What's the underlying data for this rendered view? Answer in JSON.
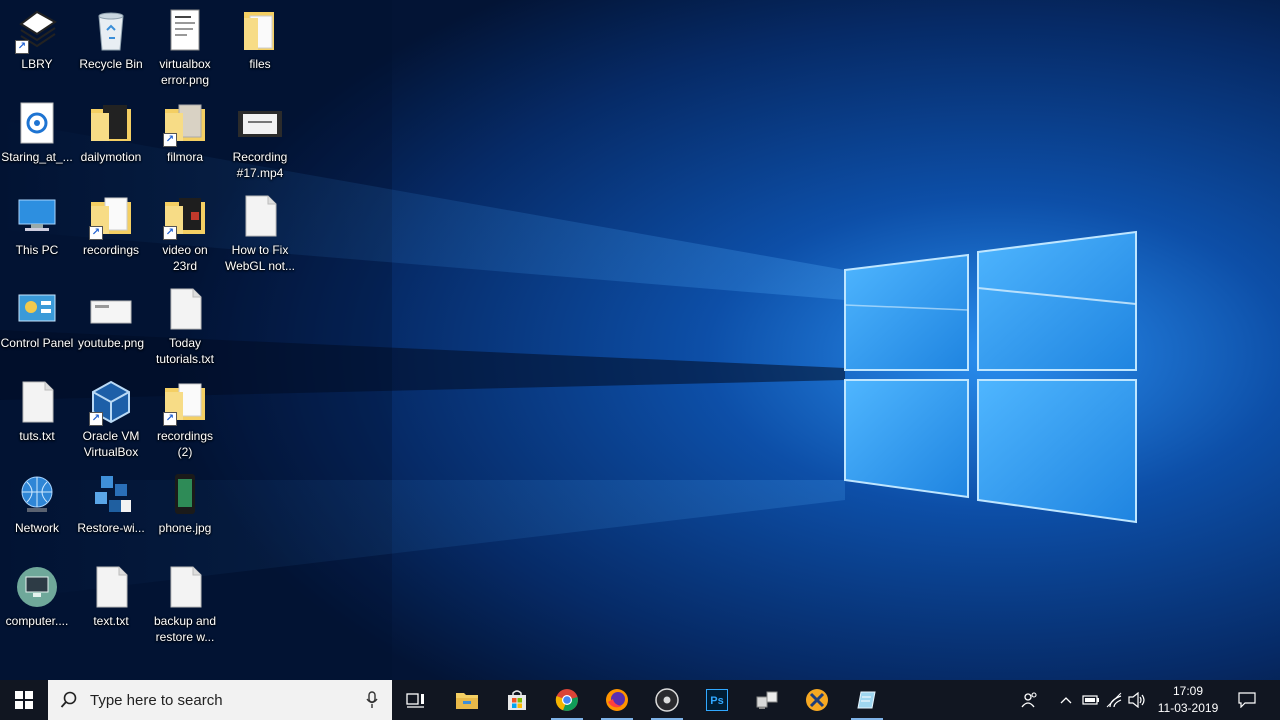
{
  "desktop": {
    "icons": [
      {
        "label": "LBRY",
        "icon": "lbry-app-icon"
      },
      {
        "label": "Recycle Bin",
        "icon": "recycle-bin-icon"
      },
      {
        "label": "virtualbox\nerror.png",
        "icon": "image-file-icon"
      },
      {
        "label": "files",
        "icon": "folder-icon"
      },
      {
        "label": "Staring_at_...",
        "icon": "media-file-icon"
      },
      {
        "label": "dailymotion",
        "icon": "folder-icon"
      },
      {
        "label": "filmora",
        "icon": "folder-icon"
      },
      {
        "label": "Recording\n#17.mp4",
        "icon": "video-file-icon"
      },
      {
        "label": "This PC",
        "icon": "this-pc-icon"
      },
      {
        "label": "recordings",
        "icon": "folder-icon"
      },
      {
        "label": "video on\n23rd",
        "icon": "folder-icon"
      },
      {
        "label": "How to Fix\nWebGL not...",
        "icon": "text-file-icon"
      },
      {
        "label": "Control Panel",
        "icon": "control-panel-icon"
      },
      {
        "label": "youtube.png",
        "icon": "image-file-icon"
      },
      {
        "label": "Today\ntutorials.txt",
        "icon": "text-file-icon"
      },
      {
        "label": "tuts.txt",
        "icon": "text-file-icon"
      },
      {
        "label": "Oracle VM\nVirtualBox",
        "icon": "virtualbox-icon"
      },
      {
        "label": "recordings\n(2)",
        "icon": "folder-icon"
      },
      {
        "label": "Network",
        "icon": "network-icon"
      },
      {
        "label": "Restore-wi...",
        "icon": "restore-package-icon"
      },
      {
        "label": "phone.jpg",
        "icon": "phone-image-icon"
      },
      {
        "label": "computer....",
        "icon": "computer-icon"
      },
      {
        "label": "text.txt",
        "icon": "text-file-icon"
      },
      {
        "label": "backup and\nrestore w...",
        "icon": "text-file-icon"
      }
    ]
  },
  "taskbar": {
    "start_icon": "windows-logo-icon",
    "search": {
      "placeholder": "Type here to search",
      "icon": "search-icon",
      "mic_icon": "microphone-icon"
    },
    "apps": [
      {
        "name": "task-view",
        "icon": "task-view-icon"
      },
      {
        "name": "file-explorer",
        "icon": "folder-icon"
      },
      {
        "name": "microsoft-store",
        "icon": "store-bag-icon"
      },
      {
        "name": "chrome",
        "icon": "chrome-icon"
      },
      {
        "name": "firefox",
        "icon": "firefox-icon"
      },
      {
        "name": "obs-studio",
        "icon": "obs-icon"
      },
      {
        "name": "photoshop",
        "icon": "photoshop-icon",
        "text": "Ps"
      },
      {
        "name": "network-tool",
        "icon": "computers-icon"
      },
      {
        "name": "xampp",
        "icon": "xampp-icon"
      },
      {
        "name": "notepad-app",
        "icon": "notepad-icon"
      }
    ],
    "tray": {
      "icons": [
        "people-icon",
        "chevron-up-icon",
        "battery-icon",
        "wifi-icon",
        "volume-icon"
      ],
      "time": "17:09",
      "date": "11-03-2019",
      "notification_icon": "action-center-icon"
    }
  },
  "colors": {
    "wallpaper_dark": "#03183d",
    "wallpaper_glow": "#1f86e6",
    "taskbar_bg": "#12161f",
    "search_bg": "#f2f2f2",
    "folder_yellow": "#f4cf63"
  }
}
